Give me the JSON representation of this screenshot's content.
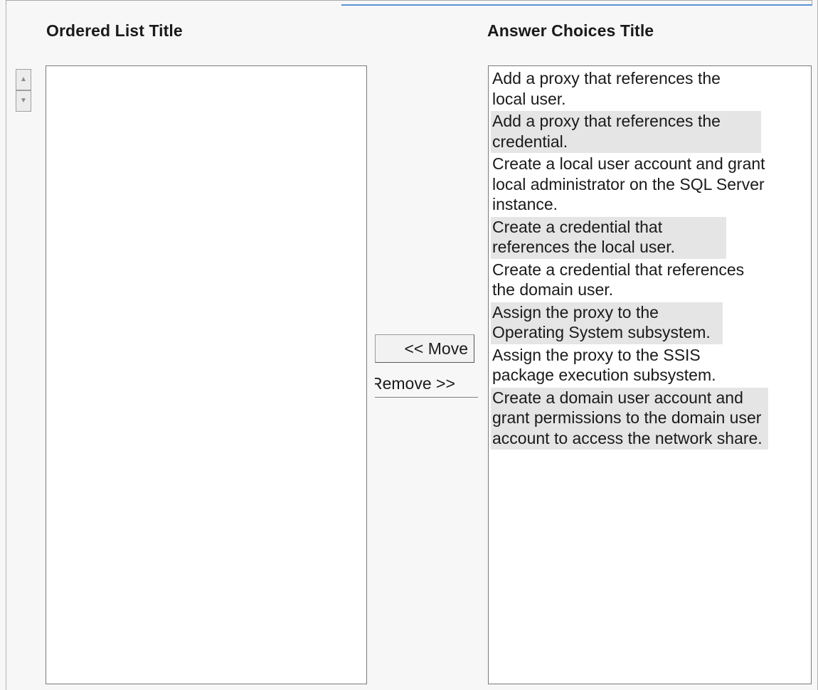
{
  "ordered_list": {
    "title": "Ordered List Title",
    "items": []
  },
  "answer_choices": {
    "title": "Answer Choices Title",
    "items": [
      "Add a proxy that references the local user.",
      "Add a proxy that references the credential.",
      "Create a local user account and grant local administrator on the SQL Server instance.",
      "Create a credential that references the local user.",
      "Create a credential that references the domain user.",
      "Assign the proxy to the Operating System subsystem.",
      "Assign the proxy to the SSIS package execution subsystem.",
      "Create a domain user account and grant permissions to the domain user account to access the network share."
    ]
  },
  "buttons": {
    "move_label": "<< Move",
    "remove_label": "Remove >>"
  },
  "icons": {
    "move_up": "up-arrow-icon",
    "move_down": "down-arrow-icon"
  },
  "colors": {
    "accent": "#5a94d6",
    "alt_row": "#e5e5e5"
  }
}
